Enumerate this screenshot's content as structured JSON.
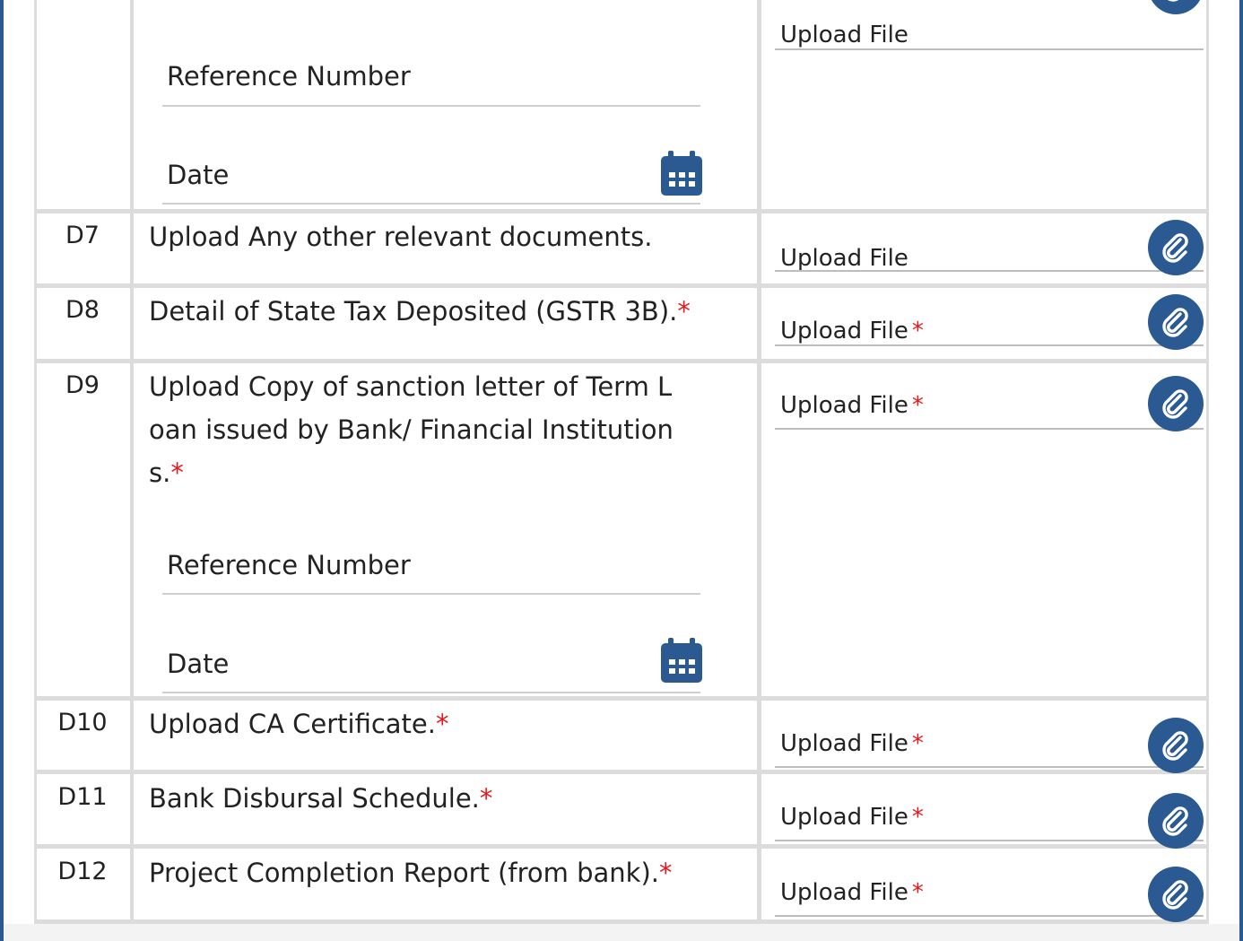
{
  "rows": [
    {
      "code": "",
      "fields": {
        "reference_label": "Reference Number",
        "date_label": "Date"
      },
      "upload_label": "Upload File"
    },
    {
      "code": "D7",
      "description": "Upload Any other relevant documents.",
      "upload_label": "Upload File",
      "required": false
    },
    {
      "code": "D8",
      "description": "Detail of State Tax Deposited (GSTR 3B).",
      "upload_label": "Upload File",
      "required": true
    },
    {
      "code": "D9",
      "description_lines": [
        "Upload Copy of sanction letter of Term L",
        "oan issued by Bank/ Financial Institution",
        "s."
      ],
      "fields": {
        "reference_label": "Reference Number",
        "date_label": "Date"
      },
      "upload_label": "Upload File",
      "required": true
    },
    {
      "code": "D10",
      "description": "Upload CA Certificate.",
      "upload_label": "Upload File",
      "required": true
    },
    {
      "code": "D11",
      "description": "Bank Disbursal Schedule.",
      "upload_label": "Upload File",
      "required": true
    },
    {
      "code": "D12",
      "description": "Project Completion Report (from bank).",
      "upload_label": "Upload File",
      "required": true
    }
  ],
  "required_marker": "*",
  "icons": {
    "attach": "paperclip-icon",
    "date": "calendar-icon"
  },
  "colors": {
    "accent": "#2b5a93",
    "required": "#e8171d",
    "border": "#dcdcdc"
  }
}
